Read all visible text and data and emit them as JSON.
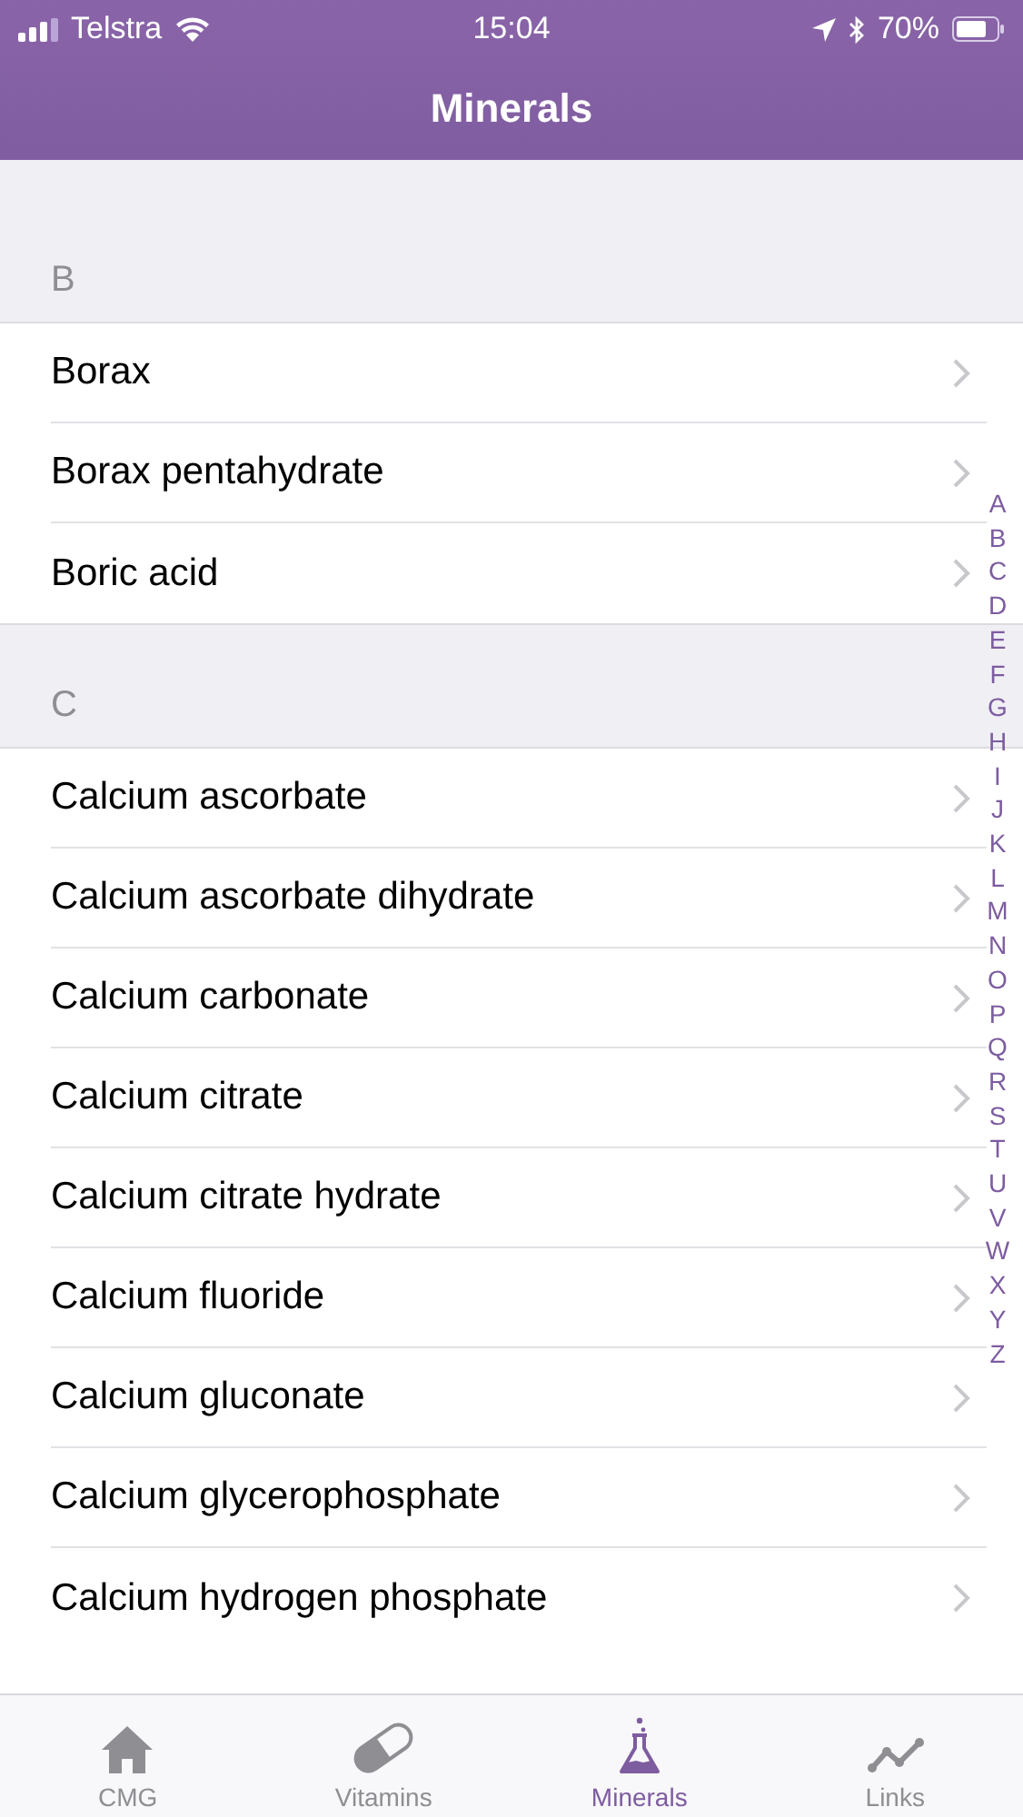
{
  "status_bar": {
    "carrier": "Telstra",
    "time": "15:04",
    "battery": "70%"
  },
  "nav_bar": {
    "title": "Minerals"
  },
  "sections": [
    {
      "header": "B",
      "rows": [
        "Borax",
        "Borax pentahydrate",
        "Boric acid"
      ]
    },
    {
      "header": "C",
      "rows": [
        "Calcium ascorbate",
        "Calcium ascorbate dihydrate",
        "Calcium carbonate",
        "Calcium citrate",
        "Calcium citrate hydrate",
        "Calcium fluoride",
        "Calcium gluconate",
        "Calcium glycerophosphate",
        "Calcium hydrogen phosphate"
      ]
    }
  ],
  "index": [
    "A",
    "B",
    "C",
    "D",
    "E",
    "F",
    "G",
    "H",
    "I",
    "J",
    "K",
    "L",
    "M",
    "N",
    "O",
    "P",
    "Q",
    "R",
    "S",
    "T",
    "U",
    "V",
    "W",
    "X",
    "Y",
    "Z"
  ],
  "tab_bar": [
    {
      "kind": "home",
      "label": "CMG",
      "selected": false
    },
    {
      "kind": "pill",
      "label": "Vitamins",
      "selected": false
    },
    {
      "kind": "flask",
      "label": "Minerals",
      "selected": true
    },
    {
      "kind": "chart",
      "label": "Links",
      "selected": false
    }
  ]
}
